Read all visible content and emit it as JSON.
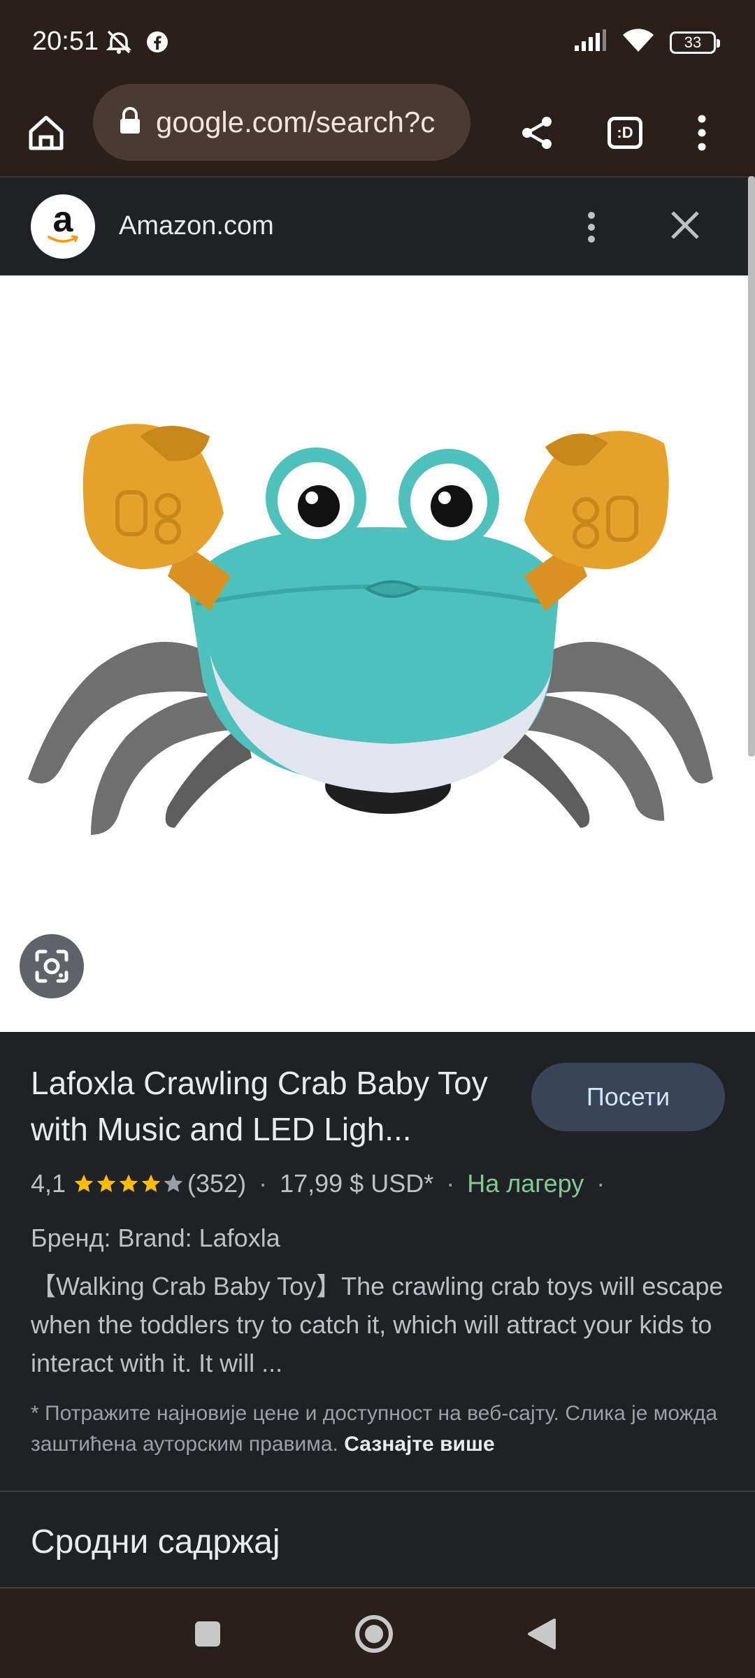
{
  "status_bar": {
    "time": "20:51",
    "icons_left": [
      "alarm-off-icon",
      "facebook-icon"
    ],
    "icons_right": [
      "signal-icon",
      "wifi-icon",
      "battery-icon"
    ],
    "battery_level": "33"
  },
  "browser": {
    "url": "google.com/search?c",
    "buttons": [
      "home-icon",
      "share-icon",
      "tabs-icon",
      "more-icon"
    ],
    "tab_count_label": ":D"
  },
  "source": {
    "name": "Amazon.com",
    "logo_letter": "a"
  },
  "product": {
    "title": "Lafoxla Crawling Crab Baby Toy with Music and LED Ligh...",
    "visit_label": "Посети",
    "rating": "4,1",
    "rating_value": 4.1,
    "reviews": "(352)",
    "price": "17,99 $ USD*",
    "availability": "На лагеру",
    "separator": "·",
    "brand_line": "Бренд: Brand: Lafoxla",
    "description": "【Walking Crab Baby Toy】The crawling crab toys will escape when the toddlers try to catch it, which will attract your kids to interact with it. It will ...",
    "disclaimer_text": "* Потражите најновије цене и доступност на веб-сајту. Слика је можда заштићена ауторским правима. ",
    "disclaimer_link": "Сазнајте више"
  },
  "related": {
    "heading": "Сродни садржај"
  },
  "colors": {
    "crab_shell": "#4fc1bc",
    "crab_claw": "#e5a12a",
    "crab_legs": "#707070",
    "stock_green": "#81c995",
    "star_gold": "#fbbc04"
  }
}
